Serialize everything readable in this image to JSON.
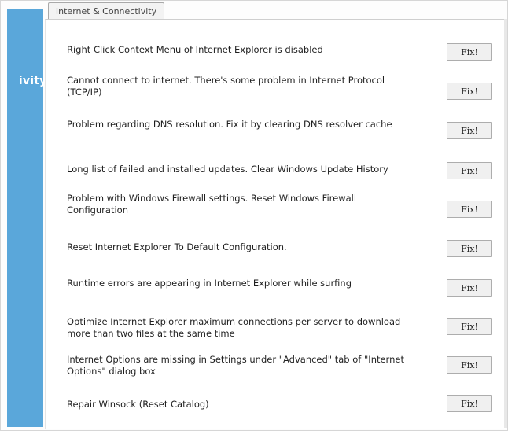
{
  "sidebar": {
    "label": "tivity"
  },
  "tab": {
    "label": "Internet & Connectivity"
  },
  "fix_label": "Fix!",
  "issues": [
    {
      "text": "Right Click Context Menu of Internet Explorer is disabled"
    },
    {
      "text": "Cannot connect to internet. There's some problem in Internet Protocol (TCP/IP)"
    },
    {
      "text": "Problem regarding DNS resolution. Fix it by clearing DNS resolver cache"
    },
    {
      "text": "Long list of failed and installed updates. Clear Windows Update History"
    },
    {
      "text": "Problem with Windows Firewall settings. Reset Windows Firewall Configuration"
    },
    {
      "text": "Reset Internet Explorer To Default Configuration."
    },
    {
      "text": "Runtime errors are appearing in Internet Explorer while surfing"
    },
    {
      "text": "Optimize Internet Explorer maximum connections per server to download more than two files at the same time"
    },
    {
      "text": "Internet Options are missing in Settings under \"Advanced\" tab of \"Internet Options\" dialog box"
    },
    {
      "text": "Repair Winsock (Reset Catalog)"
    }
  ],
  "colors": {
    "sidebar": "#5aa7da",
    "button_bg": "#f0f0f0",
    "button_border": "#adadad"
  }
}
